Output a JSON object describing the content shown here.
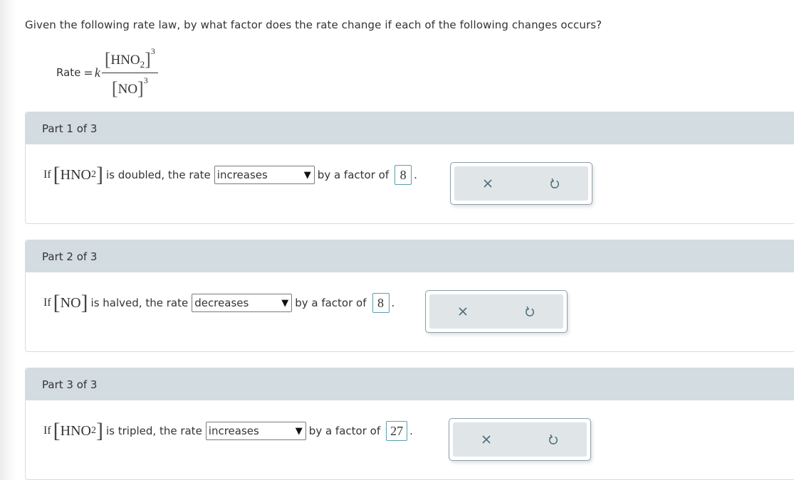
{
  "question": "Given the following rate law, by what factor does the rate change if each of the following changes occurs?",
  "rate_law": {
    "lhs": "Rate",
    "equals": "=",
    "constant": "k",
    "numerator_species": "HNO",
    "numerator_subscript": "2",
    "numerator_exponent": "3",
    "denominator_species": "NO",
    "denominator_exponent": "3"
  },
  "parts": [
    {
      "header": "Part 1 of 3",
      "if": "If",
      "species": "HNO",
      "subscript": "2",
      "change_text": "is doubled, the rate",
      "direction": "increases",
      "factor_text": "by a factor of",
      "factor": "8",
      "period": "."
    },
    {
      "header": "Part 2 of 3",
      "if": "If",
      "species": "NO",
      "subscript": "",
      "change_text": "is halved, the rate",
      "direction": "decreases",
      "factor_text": "by a factor of",
      "factor": "8",
      "period": "."
    },
    {
      "header": "Part 3 of 3",
      "if": "If",
      "species": "HNO",
      "subscript": "2",
      "change_text": "is tripled, the rate",
      "direction": "increases",
      "factor_text": "by a factor of",
      "factor": "27",
      "period": "."
    }
  ],
  "icons": {
    "clear": "close-icon",
    "reset": "undo-icon",
    "dropdown": "dropdown-arrow-icon"
  },
  "colors": {
    "header_bg": "#d3dce0",
    "answer_border": "#5b9fae",
    "action_bg": "#e0e6e8",
    "icon_color": "#4d6b78"
  }
}
